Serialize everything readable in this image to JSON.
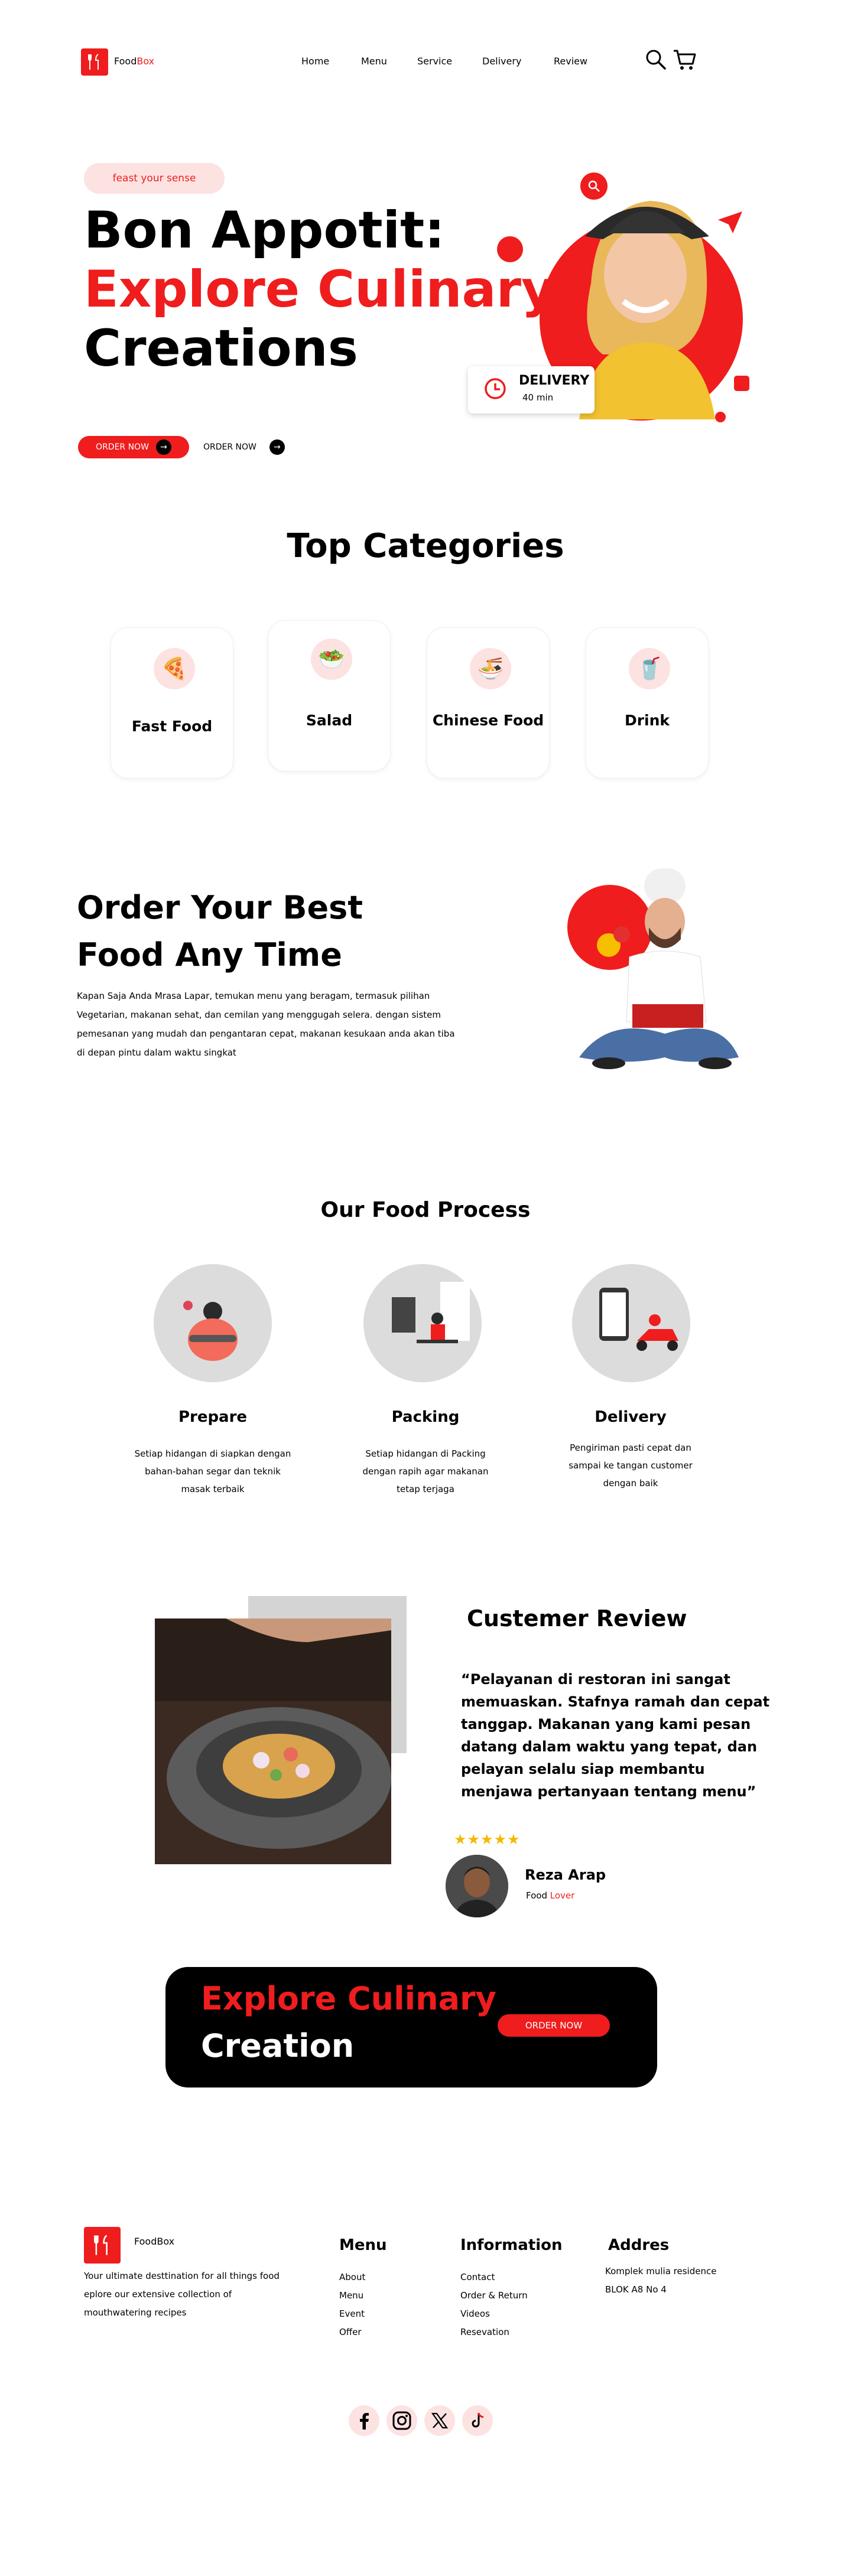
{
  "nav": {
    "brand_a": "Food",
    "brand_b": "Box",
    "links": [
      "Home",
      "Menu",
      "Service",
      "Delivery",
      "Review"
    ],
    "search_icon": "search-icon",
    "cart_icon": "cart-icon"
  },
  "hero": {
    "tag": "feast your sense",
    "line1": "Bon Appotit:",
    "line2": "Explore Culinary",
    "line3": "Creations",
    "primary_btn": "ORDER NOW",
    "secondary_btn": "ORDER NOW",
    "delivery_title": "DELIVERY",
    "delivery_time": "40 min"
  },
  "categories": {
    "title": "Top Categories",
    "items": [
      {
        "label": "Fast Food",
        "icon": "pizza-icon"
      },
      {
        "label": "Salad",
        "icon": "salad-icon"
      },
      {
        "label": "Chinese Food",
        "icon": "noodles-icon"
      },
      {
        "label": "Drink",
        "icon": "drink-icon"
      }
    ]
  },
  "order": {
    "line1": "Order Your Best",
    "line2": "Food Any Time",
    "desc": "Kapan Saja Anda Mrasa Lapar, temukan menu yang beragam, termasuk pilihan Vegetarian, makanan sehat, dan cemilan yang menggugah selera. dengan sistem pemesanan yang mudah dan pengantaran cepat, makanan kesukaan anda akan tiba di depan pintu dalam waktu singkat"
  },
  "process": {
    "title": "Our Food Process",
    "steps": [
      {
        "name": "Prepare",
        "desc": "Setiap hidangan di siapkan dengan bahan-bahan segar dan teknik masak terbaik"
      },
      {
        "name": "Packing",
        "desc": "Setiap hidangan di Packing dengan rapih agar makanan tetap terjaga"
      },
      {
        "name": "Delivery",
        "desc": "Pengiriman pasti cepat dan sampai ke tangan customer dengan baik"
      }
    ]
  },
  "review": {
    "title": "Custemer Review",
    "quote": "“Pelayanan di restoran ini sangat memuaskan. Stafnya ramah dan cepat tanggap. Makanan yang kami pesan datang dalam waktu yang tepat, dan pelayan selalu siap membantu menjawa pertanyaan tentang menu”",
    "rating": 5,
    "stars": "★★★★★",
    "name": "Reza Arap",
    "role_a": "Food",
    "role_b": "Lover"
  },
  "cta": {
    "line1": "Explore Culinary",
    "line2": "Creation",
    "btn": "ORDER NOW"
  },
  "footer": {
    "brand": "FoodBox",
    "desc": "Your ultimate desttination for all things food eplore our extensive collection of mouthwatering recipes",
    "menu_title": "Menu",
    "menu": [
      "About",
      "Menu",
      "Event",
      "Offer"
    ],
    "info_title": "Information",
    "info": [
      "Contact",
      "Order & Return",
      "Videos",
      "Resevation"
    ],
    "addr_title": "Addres",
    "addr": [
      "Komplek mulia residence",
      "BLOK A8 No 4"
    ],
    "socials": [
      "facebook-icon",
      "instagram-icon",
      "x-icon",
      "tiktok-icon"
    ]
  },
  "colors": {
    "accent": "#EF1D1D",
    "accent_light": "#FDE2E2",
    "dark": "#000000"
  }
}
